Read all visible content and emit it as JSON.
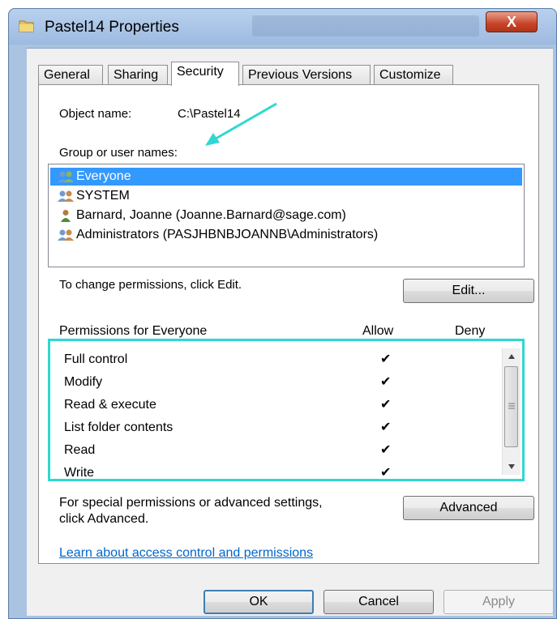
{
  "window": {
    "title": "Pastel14 Properties",
    "close_label": "X"
  },
  "tabs": [
    {
      "label": "General"
    },
    {
      "label": "Sharing"
    },
    {
      "label": "Security"
    },
    {
      "label": "Previous Versions"
    },
    {
      "label": "Customize"
    }
  ],
  "security": {
    "object_name_label": "Object name:",
    "object_name_value": "C:\\Pastel14",
    "group_label": "Group or user names:",
    "users": [
      {
        "name": "Everyone",
        "icon": "group-icon",
        "selected": true
      },
      {
        "name": "SYSTEM",
        "icon": "group-icon",
        "selected": false
      },
      {
        "name": "Barnard, Joanne (Joanne.Barnard@sage.com)",
        "icon": "user-icon",
        "selected": false
      },
      {
        "name": "Administrators (PASJHBNBJOANNB\\Administrators)",
        "icon": "group-icon",
        "selected": false
      }
    ],
    "change_text": "To change permissions, click Edit.",
    "edit_button": "Edit...",
    "permissions_header": "Permissions for Everyone",
    "allow_header": "Allow",
    "deny_header": "Deny",
    "permissions": [
      {
        "name": "Full control",
        "allow": "✔",
        "deny": ""
      },
      {
        "name": "Modify",
        "allow": "✔",
        "deny": ""
      },
      {
        "name": "Read & execute",
        "allow": "✔",
        "deny": ""
      },
      {
        "name": "List folder contents",
        "allow": "✔",
        "deny": ""
      },
      {
        "name": "Read",
        "allow": "✔",
        "deny": ""
      },
      {
        "name": "Write",
        "allow": "✔",
        "deny": ""
      }
    ],
    "special_text_line1": "For special permissions or advanced settings,",
    "special_text_line2": "click Advanced.",
    "advanced_button": "Advanced",
    "learn_link": "Learn about access control and permissions"
  },
  "footer": {
    "ok": "OK",
    "cancel": "Cancel",
    "apply": "Apply"
  },
  "colors": {
    "highlight": "#3399ff",
    "annotation": "#2ed8d0"
  }
}
